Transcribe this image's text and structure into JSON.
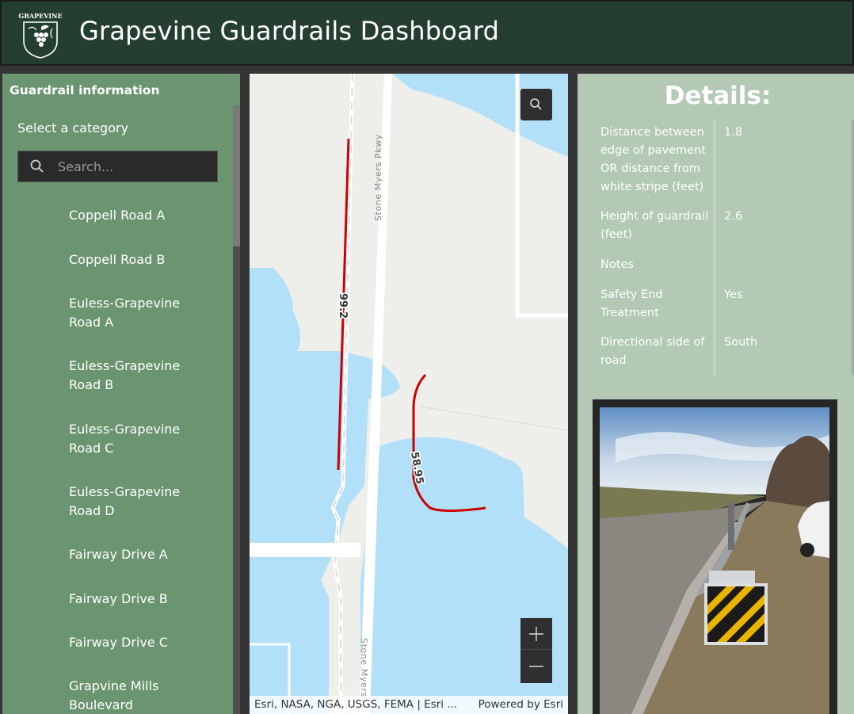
{
  "header": {
    "title": "Grapevine Guardrails Dashboard",
    "logo_text": "GRAPEVINE"
  },
  "sidebar": {
    "title": "Guardrail information",
    "category_label": "Select a category",
    "search_placeholder": "Search...",
    "items": [
      {
        "label": "Coppell Road A"
      },
      {
        "label": "Coppell Road B"
      },
      {
        "label": "Euless-Grapevine Road A"
      },
      {
        "label": "Euless-Grapevine Road B"
      },
      {
        "label": "Euless-Grapevine Road C"
      },
      {
        "label": "Euless-Grapevine Road D"
      },
      {
        "label": "Fairway Drive A"
      },
      {
        "label": "Fairway Drive B"
      },
      {
        "label": "Fairway Drive C"
      },
      {
        "label": "Grapvine Mills Boulevard"
      }
    ]
  },
  "map": {
    "road_label_top": "Stone Myers Pkwy",
    "road_label_bottom": "Stone Myers",
    "route_label_1": "99.2",
    "route_label_2": "58.95",
    "attribution": "Esri, NASA, NGA, USGS, FEMA | Esri ...",
    "powered_by": "Powered by Esri",
    "zoom_in_symbol": "+",
    "zoom_out_symbol": "—",
    "colors": {
      "water": "#b2e0f8",
      "land": "#eeeeea",
      "route": "#cc0000"
    }
  },
  "details": {
    "title": "Details:",
    "fields": [
      {
        "name": "Distance between edge of pavement OR distance from white stripe (feet)",
        "value": "1.8"
      },
      {
        "name": "Height of guardrail (feet)",
        "value": "2.6"
      },
      {
        "name": "Notes",
        "value": ""
      },
      {
        "name": "Safety End Treatment",
        "value": "Yes"
      },
      {
        "name": "Directional side of road",
        "value": "South"
      }
    ]
  }
}
